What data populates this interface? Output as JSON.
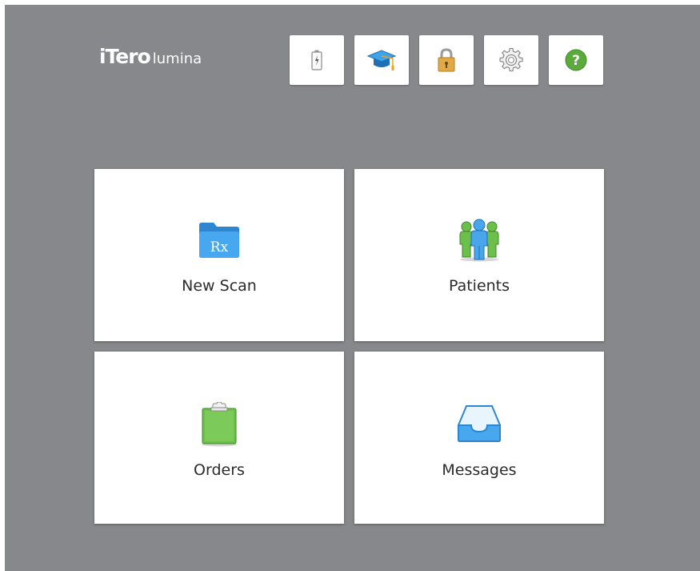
{
  "app": {
    "brand": "iTero",
    "product": "lumina"
  },
  "toolbar": {
    "buttons": [
      {
        "name": "battery",
        "icon": "battery-icon"
      },
      {
        "name": "learning-center",
        "icon": "graduation-cap-icon"
      },
      {
        "name": "lock",
        "icon": "lock-icon"
      },
      {
        "name": "settings",
        "icon": "gear-icon"
      },
      {
        "name": "help",
        "icon": "help-icon",
        "glyph": "?"
      }
    ]
  },
  "tiles": {
    "new_scan": {
      "label": "New Scan",
      "icon": "rx-folder-icon",
      "icon_text": "Rx"
    },
    "patients": {
      "label": "Patients",
      "icon": "patients-icon"
    },
    "orders": {
      "label": "Orders",
      "icon": "clipboard-icon"
    },
    "messages": {
      "label": "Messages",
      "icon": "inbox-tray-icon"
    }
  },
  "colors": {
    "background": "#87888b",
    "tile": "#ffffff",
    "accent_blue": "#3a9be0",
    "accent_green": "#6bbf4a",
    "help_green": "#5aaa3c",
    "lock_gold": "#d9a441"
  }
}
